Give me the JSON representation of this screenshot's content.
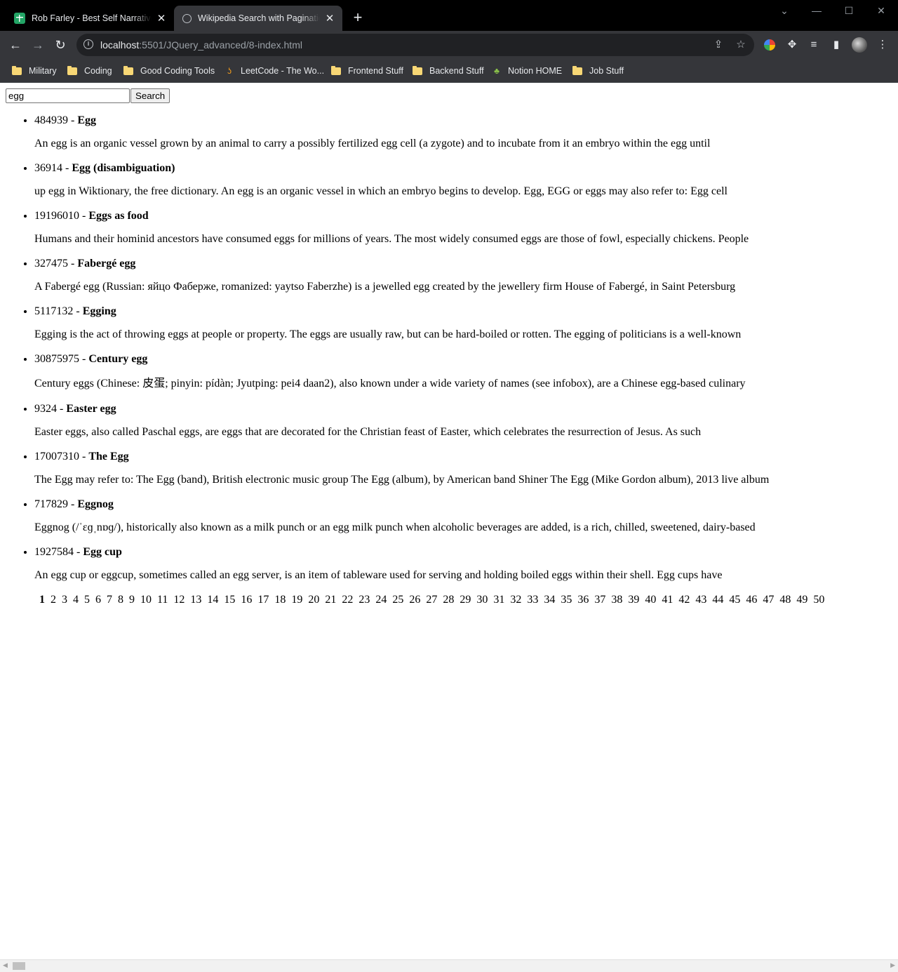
{
  "browser": {
    "tabs": [
      {
        "title": "Rob Farley - Best Self Narrative (",
        "icon": "sheets-icon",
        "active": false
      },
      {
        "title": "Wikipedia Search with Pagination",
        "icon": "globe-icon",
        "active": true
      }
    ],
    "url_host": "localhost",
    "url_path": ":5501/JQuery_advanced/8-index.html",
    "bookmarks": [
      {
        "label": "Military",
        "icon": "folder-icon"
      },
      {
        "label": "Coding",
        "icon": "folder-icon"
      },
      {
        "label": "Good Coding Tools",
        "icon": "folder-icon"
      },
      {
        "label": "LeetCode - The Wo...",
        "icon": "leetcode-icon"
      },
      {
        "label": "Frontend Stuff",
        "icon": "folder-icon"
      },
      {
        "label": "Backend Stuff",
        "icon": "folder-icon"
      },
      {
        "label": "Notion HOME",
        "icon": "sprout-icon"
      },
      {
        "label": "Job Stuff",
        "icon": "folder-icon"
      }
    ]
  },
  "search": {
    "value": "egg",
    "button_label": "Search"
  },
  "results": [
    {
      "id": "484939",
      "sep": " - ",
      "title": "Egg",
      "snippet": "An egg is an organic vessel grown by an animal to carry a possibly fertilized egg cell (a zygote) and to incubate from it an embryo within the egg until"
    },
    {
      "id": "36914",
      "sep": " - ",
      "title": "Egg (disambiguation)",
      "snippet": "up egg in Wiktionary, the free dictionary. An egg is an organic vessel in which an embryo begins to develop. Egg, EGG or eggs may also refer to: Egg cell"
    },
    {
      "id": "19196010",
      "sep": " - ",
      "title": "Eggs as food",
      "snippet": "Humans and their hominid ancestors have consumed eggs for millions of years. The most widely consumed eggs are those of fowl, especially chickens. People"
    },
    {
      "id": "327475",
      "sep": " - ",
      "title": "Fabergé egg",
      "snippet": "A Fabergé egg (Russian: яйцо Фаберже, romanized: yaytso Faberzhe) is a jewelled egg created by the jewellery firm House of Fabergé, in Saint Petersburg"
    },
    {
      "id": "5117132",
      "sep": " - ",
      "title": "Egging",
      "snippet": "Egging is the act of throwing eggs at people or property. The eggs are usually raw, but can be hard-boiled or rotten. The egging of politicians is a well-known"
    },
    {
      "id": "30875975",
      "sep": " - ",
      "title": "Century egg",
      "snippet": "Century eggs (Chinese: 皮蛋; pinyin: pídàn; Jyutping: pei4 daan2), also known under a wide variety of names (see infobox), are a Chinese egg-based culinary"
    },
    {
      "id": "9324",
      "sep": " - ",
      "title": "Easter egg",
      "snippet": "Easter eggs, also called Paschal eggs, are eggs that are decorated for the Christian feast of Easter, which celebrates the resurrection of Jesus. As such"
    },
    {
      "id": "17007310",
      "sep": " - ",
      "title": "The Egg",
      "snippet": "The Egg may refer to: The Egg (band), British electronic music group The Egg (album), by American band Shiner The Egg (Mike Gordon album), 2013 live album"
    },
    {
      "id": "717829",
      "sep": " - ",
      "title": "Eggnog",
      "snippet": "Eggnog (/ˈɛɡˌnɒɡ/), historically also known as a milk punch or an egg milk punch when alcoholic beverages are added, is a rich, chilled, sweetened, dairy-based"
    },
    {
      "id": "1927584",
      "sep": " - ",
      "title": "Egg cup",
      "snippet": "An egg cup or eggcup, sometimes called an egg server, is an item of tableware used for serving and holding boiled eggs within their shell. Egg cups have"
    }
  ],
  "pagination": {
    "current": "1",
    "pages": [
      "1",
      "2",
      "3",
      "4",
      "5",
      "6",
      "7",
      "8",
      "9",
      "10",
      "11",
      "12",
      "13",
      "14",
      "15",
      "16",
      "17",
      "18",
      "19",
      "20",
      "21",
      "22",
      "23",
      "24",
      "25",
      "26",
      "27",
      "28",
      "29",
      "30",
      "31",
      "32",
      "33",
      "34",
      "35",
      "36",
      "37",
      "38",
      "39",
      "40",
      "41",
      "42",
      "43",
      "44",
      "45",
      "46",
      "47",
      "48",
      "49",
      "50"
    ]
  }
}
